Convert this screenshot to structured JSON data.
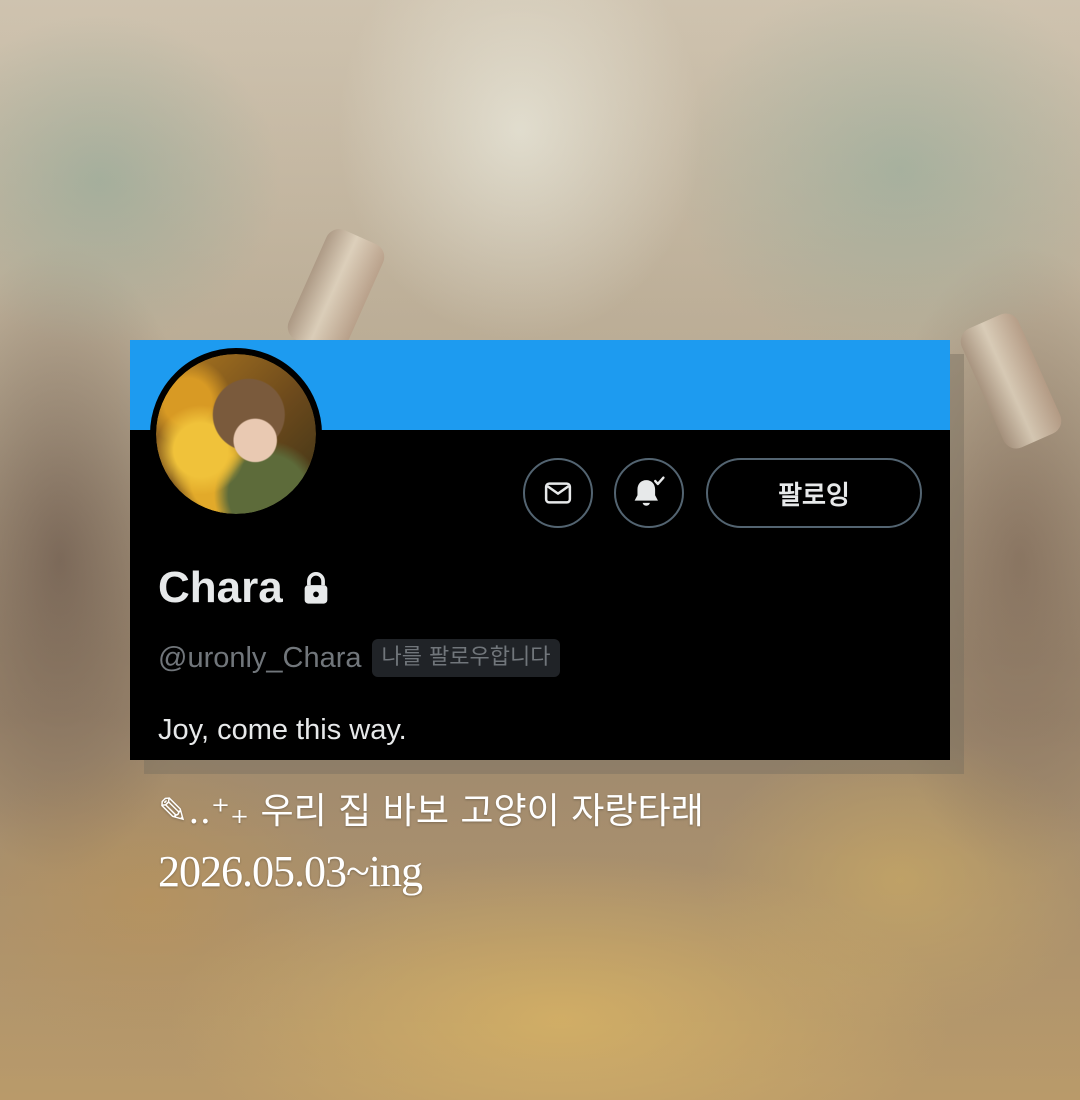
{
  "profile": {
    "display_name": "Chara",
    "handle": "@uronly_Chara",
    "follows_you_badge": "나를 팔로우합니다",
    "bio": "Joy, come this way.",
    "follow_button_label": "팔로잉",
    "icons": {
      "message": "envelope-icon",
      "notifications": "bell-check-icon",
      "protected": "lock-icon"
    },
    "colors": {
      "banner": "#1d9bf0",
      "card_background": "#000000",
      "primary_text": "#e7e9ea",
      "secondary_text": "#71767b",
      "button_border": "#536471"
    }
  },
  "caption": {
    "line1": "✎..⁺₊ 우리 집 바보 고양이 자랑타래",
    "line2": "2026.05.03~ing"
  }
}
